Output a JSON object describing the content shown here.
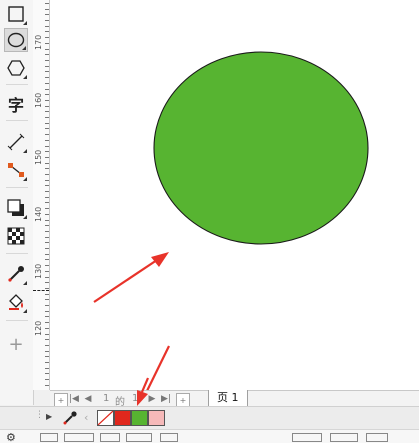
{
  "toolbox": {
    "tools": [
      {
        "name": "rectangle-tool-icon",
        "active": false
      },
      {
        "name": "ellipse-tool-icon",
        "active": true
      },
      {
        "name": "polygon-tool-icon",
        "active": false
      },
      {
        "name": "text-tool-icon",
        "glyph": "字",
        "active": false
      },
      {
        "name": "dimension-tool-icon",
        "active": false
      },
      {
        "name": "connector-tool-icon",
        "active": false
      },
      {
        "name": "drop-shadow-tool-icon",
        "active": false
      },
      {
        "name": "transparency-tool-icon",
        "active": false
      },
      {
        "name": "eyedropper-tool-icon",
        "active": false
      },
      {
        "name": "interactive-fill-tool-icon",
        "active": false
      },
      {
        "name": "add-tool-icon",
        "glyph": "+",
        "active": false
      }
    ]
  },
  "ruler": {
    "labels": [
      "170",
      "160",
      "150",
      "140",
      "130",
      "120"
    ]
  },
  "canvas": {
    "ellipse_fill": "#57b431",
    "ellipse_stroke": "#1a1a1a",
    "arrow_color": "#e8332a"
  },
  "pagebar": {
    "page_current": "1",
    "page_of": "的",
    "page_total": "1",
    "page_tab_label": "页 1"
  },
  "palette": {
    "swatches": [
      {
        "name": "no-fill-swatch",
        "color": "none"
      },
      {
        "name": "red-swatch",
        "color": "#e0281d"
      },
      {
        "name": "green-swatch",
        "color": "#57b431"
      },
      {
        "name": "pink-swatch",
        "color": "#f6b9b9"
      }
    ]
  }
}
